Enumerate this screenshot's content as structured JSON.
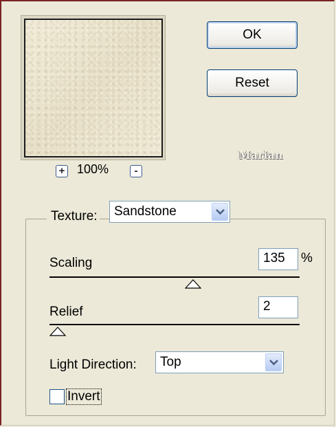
{
  "preview": {
    "zoom_level": "100%",
    "zoom_in_symbol": "+",
    "zoom_out_symbol": "-"
  },
  "buttons": {
    "ok_label": "OK",
    "reset_label": "Reset"
  },
  "watermark": "Marian",
  "texture": {
    "label": "Texture:",
    "value": "Sandstone"
  },
  "scaling": {
    "label": "Scaling",
    "value": "135",
    "unit": "%",
    "slider_fraction": 0.58
  },
  "relief": {
    "label": "Relief",
    "value": "2",
    "slider_fraction": 0.0
  },
  "light_direction": {
    "label": "Light Direction:",
    "value": "Top"
  },
  "invert": {
    "label": "Invert",
    "checked": false
  },
  "colors": {
    "dialog_bg": "#ece9d8",
    "frame_accent": "#7a2222",
    "field_border": "#7f9db9",
    "button_border": "#003c74"
  }
}
